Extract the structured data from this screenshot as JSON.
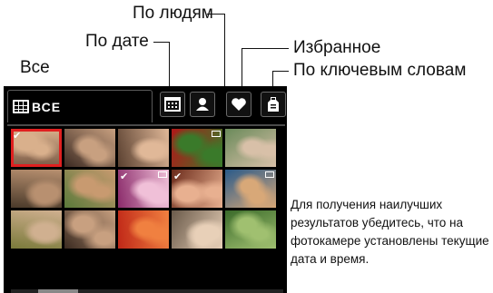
{
  "callouts": {
    "by_people": "По людям",
    "by_date": "По дате",
    "favorites": "Избранное",
    "all": "Все",
    "by_keywords": "По ключевым словам"
  },
  "screen": {
    "all_tab_label": "ВСЕ",
    "tab_icons": [
      "calendar-icon",
      "person-icon",
      "heart-icon",
      "tag-icon"
    ]
  },
  "thumbnails": [
    {
      "desc": "couple",
      "selected": true,
      "checked": true,
      "c1": "#7a5a46",
      "c2": "#d9b08c"
    },
    {
      "desc": "family",
      "selected": false,
      "checked": false,
      "c1": "#3c2a22",
      "c2": "#c8a080"
    },
    {
      "desc": "girls",
      "selected": false,
      "checked": false,
      "c1": "#5a4030",
      "c2": "#e0b898"
    },
    {
      "desc": "tomatoes",
      "selected": false,
      "checked": false,
      "c1": "#b01818",
      "c2": "#3a7a2a",
      "badge": true
    },
    {
      "desc": "woman-outdoor",
      "selected": false,
      "checked": false,
      "c1": "#6a8a5a",
      "c2": "#d8c0a8"
    },
    {
      "desc": "group",
      "selected": false,
      "checked": false,
      "c1": "#4a3a2a",
      "c2": "#b89070"
    },
    {
      "desc": "guitar",
      "selected": false,
      "checked": false,
      "c1": "#5a7a3a",
      "c2": "#c89a70"
    },
    {
      "desc": "flowers",
      "selected": false,
      "checked": true,
      "c1": "#8a2a6a",
      "c2": "#f0c0d8",
      "badge": true
    },
    {
      "desc": "portrait",
      "selected": false,
      "checked": true,
      "c1": "#6a2a1a",
      "c2": "#e8b090"
    },
    {
      "desc": "kid-water",
      "selected": false,
      "checked": false,
      "c1": "#2a5a8a",
      "c2": "#d8a878",
      "badge": true
    },
    {
      "desc": "kids",
      "selected": false,
      "checked": false,
      "c1": "#7a7a3a",
      "c2": "#d0b090"
    },
    {
      "desc": "couple-2",
      "selected": false,
      "checked": false,
      "c1": "#3a2a20",
      "c2": "#c8a080"
    },
    {
      "desc": "leaf",
      "selected": false,
      "checked": false,
      "c1": "#c02818",
      "c2": "#f08040"
    },
    {
      "desc": "baby",
      "selected": false,
      "checked": false,
      "c1": "#6a5a4a",
      "c2": "#e8d0b8"
    },
    {
      "desc": "waterfall",
      "selected": false,
      "checked": false,
      "c1": "#3a6a2a",
      "c2": "#a0c070"
    }
  ],
  "note": "Для получения наилучших результатов убедитесь, что на фотокамере установлены текущие дата и время.",
  "colors": {
    "selection": "#e02020",
    "screen_bg": "#000000"
  }
}
